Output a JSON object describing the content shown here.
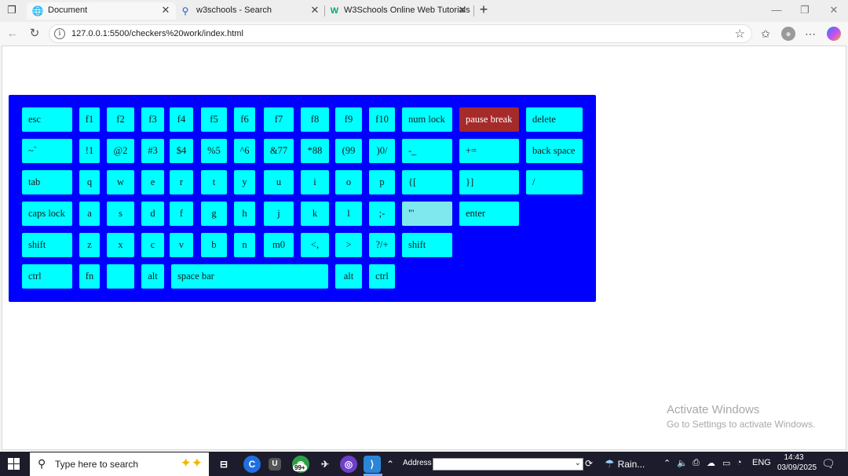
{
  "browser": {
    "tabs": [
      {
        "label": "Document",
        "icon": "globe-icon",
        "close": "✕"
      },
      {
        "label": "w3schools - Search",
        "icon": "search-icon",
        "close": "✕"
      },
      {
        "label": "W3Schools Online Web Tutorials",
        "icon": "w3schools-icon",
        "close": "✕"
      }
    ],
    "new_tab": "+",
    "url": "127.0.0.1:5500/checkers%20work/index.html"
  },
  "keyboard": {
    "colors": {
      "board": "#0000ff",
      "key": "#00ffff",
      "highlight": "#a52a2a"
    },
    "rows": [
      [
        "esc",
        "f1",
        "f2",
        "f3",
        "f4",
        "f5",
        "f6",
        "f7",
        "f8",
        "f9",
        "f10",
        "num lock",
        "pause break",
        "delete"
      ],
      [
        "~`",
        "!1",
        "@2",
        "#3",
        "$4",
        "%5",
        "^6",
        "&77",
        "*88",
        "(99",
        ")0/",
        "-_",
        "+=",
        "back space"
      ],
      [
        "tab",
        "q",
        "w",
        "e",
        "r",
        "t",
        "y",
        "u",
        "i",
        "o",
        "p",
        "{[",
        "}]",
        "/"
      ],
      [
        "caps lock",
        "a",
        "s",
        "d",
        "f",
        "g",
        "h",
        "j",
        "k",
        "l",
        ";-",
        "\"'",
        "enter"
      ],
      [
        "shift",
        "z",
        "x",
        "c",
        "v",
        "b",
        "n",
        "m0",
        "<,",
        ">",
        "?/+",
        "shift"
      ],
      [
        "ctrl",
        "fn",
        "",
        "alt",
        "space bar",
        "alt",
        "ctrl"
      ]
    ]
  },
  "watermark": {
    "title": "Activate Windows",
    "subtitle": "Go to Settings to activate Windows."
  },
  "taskbar": {
    "search_placeholder": "Type here to search",
    "badge": "99+",
    "address_label": "Address",
    "weather": "Rain...",
    "language": "ENG",
    "time": "14:43",
    "date": "03/09/2025"
  }
}
